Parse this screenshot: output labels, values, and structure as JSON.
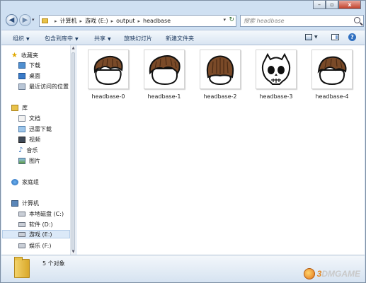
{
  "window": {
    "controls": {
      "minimize": "–",
      "maximize": "▫",
      "close": "x"
    }
  },
  "address": {
    "crumbs": [
      "计算机",
      "游戏 (E:)",
      "output",
      "headbase"
    ],
    "search_placeholder": "搜索 headbase"
  },
  "toolbar": {
    "organize": "组织",
    "include_in_library": "包含到库中",
    "share": "共享",
    "slideshow": "放映幻灯片",
    "new_folder": "新建文件夹",
    "help": "?"
  },
  "nav": {
    "favorites": "收藏夹",
    "downloads": "下载",
    "desktop": "桌面",
    "recent": "最近访问的位置",
    "libraries": "库",
    "documents": "文档",
    "xunlei": "迅雷下载",
    "videos": "视频",
    "music": "音乐",
    "pictures": "图片",
    "homegroup": "家庭组",
    "computer": "计算机",
    "drive_c": "本地磁盘 (C:)",
    "drive_d": "软件 (D:)",
    "drive_e": "游戏 (E:)",
    "drive_f": "娱乐 (F:)"
  },
  "files": [
    {
      "name": "headbase-0",
      "icon": "hair-head-thumbnail"
    },
    {
      "name": "headbase-1",
      "icon": "hair-head-thumbnail"
    },
    {
      "name": "headbase-2",
      "icon": "hair-head-thumbnail"
    },
    {
      "name": "headbase-3",
      "icon": "skull-mask-thumbnail"
    },
    {
      "name": "headbase-4",
      "icon": "hair-head-thumbnail"
    }
  ],
  "status": {
    "count": "5 个对象"
  },
  "watermark": {
    "number": "3",
    "rest": "DMGAME"
  },
  "colors": {
    "hair": "#7a4a28",
    "folder": "#e8c24a",
    "selection": "#dbe9f8"
  }
}
